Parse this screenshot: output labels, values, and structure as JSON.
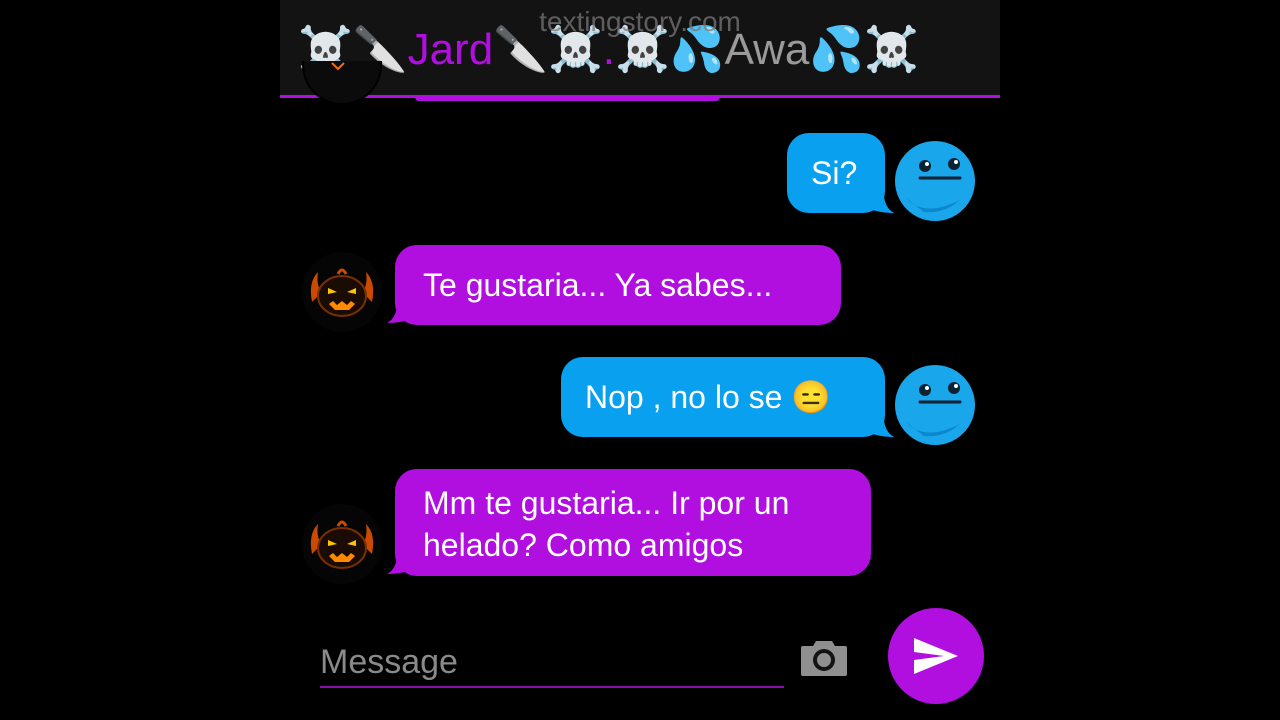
{
  "watermark": "textingstory.com",
  "header": {
    "title_prefix": "☠️🔪",
    "name_a": "Jard",
    "mid": "🔪☠️",
    "sep": ".",
    "mid2": "☠️💦",
    "name_b": "Awa",
    "title_suffix": "💦☠️"
  },
  "messages": [
    {
      "sender": "me",
      "text": "Si?"
    },
    {
      "sender": "other",
      "text": "Te gustaria... Ya sabes..."
    },
    {
      "sender": "me",
      "text": "Nop , no lo se 😑"
    },
    {
      "sender": "other",
      "line1": "Mm te gustaria... Ir por un",
      "line2": "helado? Como amigos"
    }
  ],
  "composer": {
    "placeholder": "Message"
  },
  "colors": {
    "me_bubble": "#0aa0f0",
    "other_bubble": "#b10ee0",
    "accent": "#b10ee0"
  },
  "icons": {
    "camera": "camera-icon",
    "send": "send-icon",
    "avatar_other": "pumpkin-avatar",
    "avatar_me": "blue-face-avatar"
  }
}
